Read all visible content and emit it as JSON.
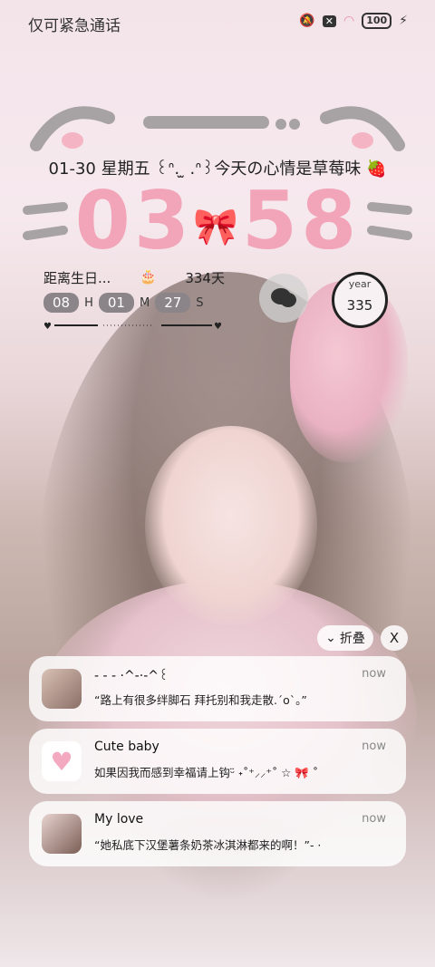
{
  "status_bar": {
    "carrier": "仅可紧急通话",
    "battery": "100"
  },
  "lockscreen": {
    "date_line": "01-30 星期五 ꒰ᐢ. ̫ .ᐢ꒱今天の心情是草莓味 🍓",
    "clock": {
      "hours": "03",
      "minutes": "58"
    }
  },
  "birthday_widget": {
    "label": "距离生日...",
    "cake": "🎂",
    "days": "334天",
    "hours": "08",
    "h": "H",
    "minutes": "01",
    "m": "M",
    "seconds": "27",
    "s": "S"
  },
  "year_widget": {
    "label": "year",
    "value": "335"
  },
  "notification_actions": {
    "fold": "折叠",
    "close": "X"
  },
  "notifications": [
    {
      "title": "- ‐ ‐ ·^-·-^꒰  ",
      "body": "“路上有很多绊脚石  拜托别和我走散.ˊoˋ。”",
      "time": "now"
    },
    {
      "title": "Cute baby",
      "body": "如果因我而感到幸福请上钩ᵕ̈ ˖˚⁺⸝⸝⁺˚ ☆ 🎀 ˚",
      "time": "now"
    },
    {
      "title": "My love",
      "body": "“她私底下汉堡薯条奶茶冰淇淋都来的啊！”- ·",
      "time": "now"
    }
  ],
  "colors": {
    "clock": "#f2a5b9",
    "accent": "#f2a5b9"
  }
}
